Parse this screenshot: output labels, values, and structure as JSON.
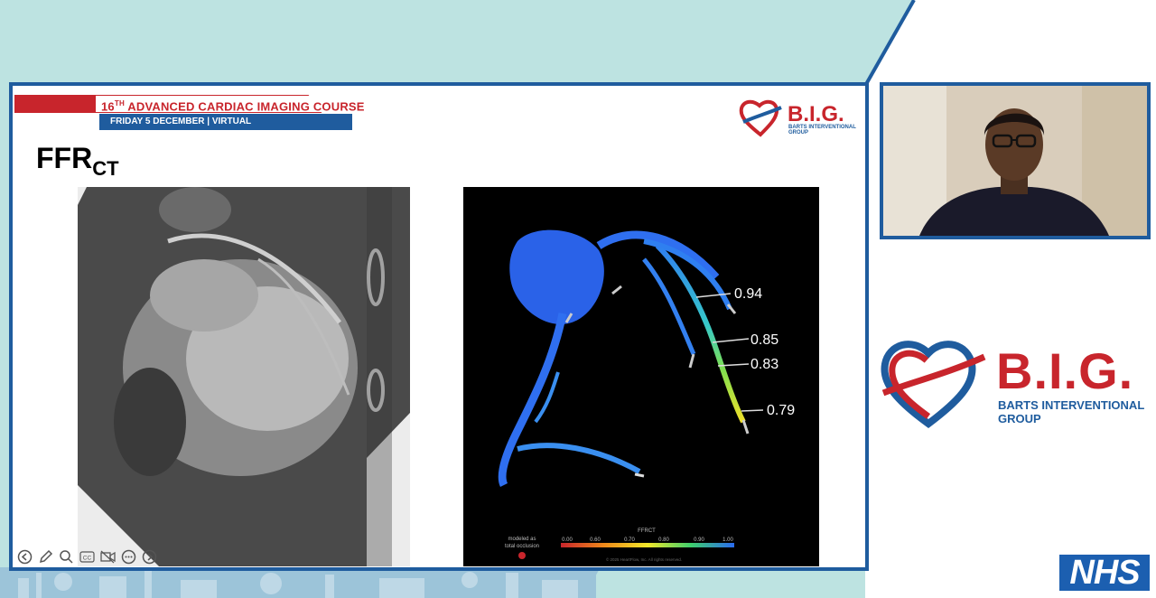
{
  "slide": {
    "course_number": "16",
    "course_suffix": "TH",
    "course_title": "ADVANCED CARDIAC IMAGING COURSE",
    "subtitle": "FRIDAY 5 DECEMBER | VIRTUAL",
    "title_main": "FFR",
    "title_sub": "CT",
    "logo_text": "B.I.G.",
    "logo_sub": "BARTS INTERVENTIONAL GROUP"
  },
  "ffr_figure": {
    "values": [
      {
        "label": "0.94"
      },
      {
        "label": "0.85"
      },
      {
        "label": "0.83"
      },
      {
        "label": "0.79"
      }
    ],
    "legend_title": "FFRCT",
    "legend_ticks": [
      "0.00",
      "0.60",
      "0.70",
      "0.80",
      "0.90",
      "1.00"
    ],
    "occlusion_note_1": "modeled as",
    "occlusion_note_2": "total occlusion",
    "copyright": "© 2025 HeartFlow, Inc. All rights reserved."
  },
  "controls": {
    "icons": [
      "back-arrow-icon",
      "pen-icon",
      "zoom-icon",
      "captions-icon",
      "video-icon",
      "more-icon",
      "forward-arrow-icon"
    ],
    "cc_label": "CC"
  },
  "sidebar": {
    "logo_text": "B.I.G.",
    "logo_sub": "BARTS INTERVENTIONAL GROUP",
    "nhs_label": "NHS"
  },
  "colors": {
    "brand_blue": "#1f5c9e",
    "brand_red": "#c8252c",
    "teal_bg": "#bde3e1",
    "nhs_blue": "#1c5fb0"
  }
}
